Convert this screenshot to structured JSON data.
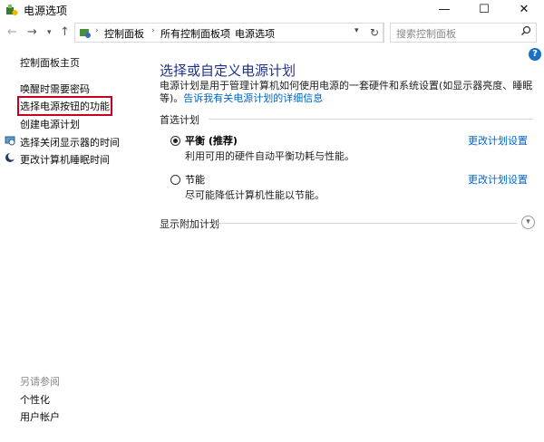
{
  "window": {
    "title": "电源选项",
    "controls": {
      "minimize": "—",
      "maximize": "☐",
      "close": "✕"
    }
  },
  "address": {
    "crumbs": [
      "控制面板",
      "所有控制面板项",
      "电源选项"
    ],
    "search_placeholder": "搜索控制面板"
  },
  "sidebar": {
    "items": [
      {
        "label": "控制面板主页"
      },
      {
        "label": "唤醒时需要密码"
      },
      {
        "label": "选择电源按钮的功能",
        "highlighted": true
      },
      {
        "label": "创建电源计划"
      },
      {
        "label": "选择关闭显示器的时间",
        "icon": "monitor-icon"
      },
      {
        "label": "更改计算机睡眠时间",
        "icon": "moon-icon"
      }
    ],
    "see_also_title": "另请参阅",
    "see_also": [
      "个性化",
      "用户帐户"
    ]
  },
  "main": {
    "heading": "选择或自定义电源计划",
    "description": "电源计划是用于管理计算机如何使用电源的一套硬件和系统设置(如显示器亮度、睡眠等)。",
    "description_link": "告诉我有关电源计划的详细信息",
    "preferred_title": "首选计划",
    "plans": [
      {
        "name": "平衡 (推荐)",
        "desc": "利用可用的硬件自动平衡功耗与性能。",
        "change": "更改计划设置",
        "selected": true
      },
      {
        "name": "节能",
        "desc": "尽可能降低计算机性能以节能。",
        "change": "更改计划设置",
        "selected": false
      }
    ],
    "additional_title": "显示附加计划"
  }
}
